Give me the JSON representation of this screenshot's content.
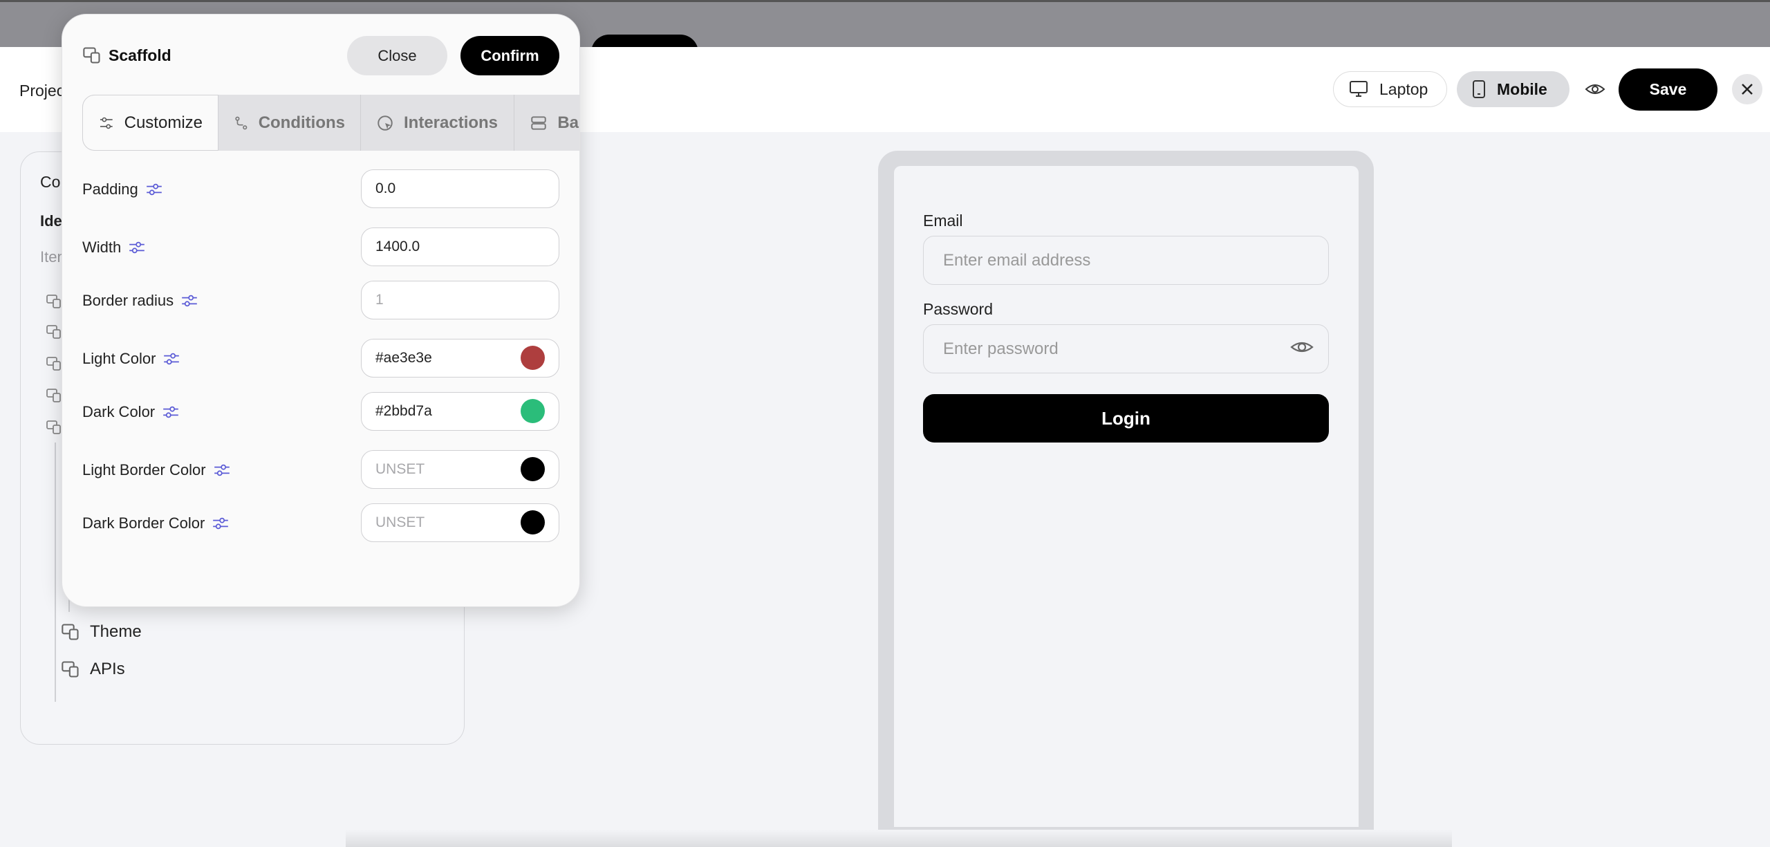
{
  "topbar": {
    "project_label": "Projec",
    "device_laptop": "Laptop",
    "device_mobile": "Mobile",
    "save_label": "Save"
  },
  "tree": {
    "title": "Co",
    "id_label": "Ide",
    "items_label": "Iten",
    "rows": [
      {
        "label": "Theme"
      },
      {
        "label": "APIs"
      }
    ]
  },
  "phone": {
    "email_label": "Email",
    "email_placeholder": "Enter email address",
    "password_label": "Password",
    "password_placeholder": "Enter password",
    "login_label": "Login"
  },
  "modal": {
    "title": "Scaffold",
    "close_label": "Close",
    "confirm_label": "Confirm",
    "tabs": [
      {
        "label": "Customize",
        "icon": "sliders-icon"
      },
      {
        "label": "Conditions",
        "icon": "branch-icon"
      },
      {
        "label": "Interactions",
        "icon": "pointer-icon"
      },
      {
        "label": "Ba",
        "icon": "server-icon"
      }
    ],
    "properties": [
      {
        "label": "Padding",
        "value": "0.0"
      },
      {
        "label": "Width",
        "value": "1400.0"
      },
      {
        "label": "Border radius",
        "placeholder": "1"
      },
      {
        "label": "Light Color",
        "value": "#ae3e3e",
        "swatch": "#ae3e3e"
      },
      {
        "label": "Dark Color",
        "value": "#2bbd7a",
        "swatch": "#2bbd7a"
      },
      {
        "label": "Light Border Color",
        "placeholder": "UNSET",
        "swatch": "#000000"
      },
      {
        "label": "Dark Border Color",
        "placeholder": "UNSET",
        "swatch": "#000000"
      }
    ]
  }
}
